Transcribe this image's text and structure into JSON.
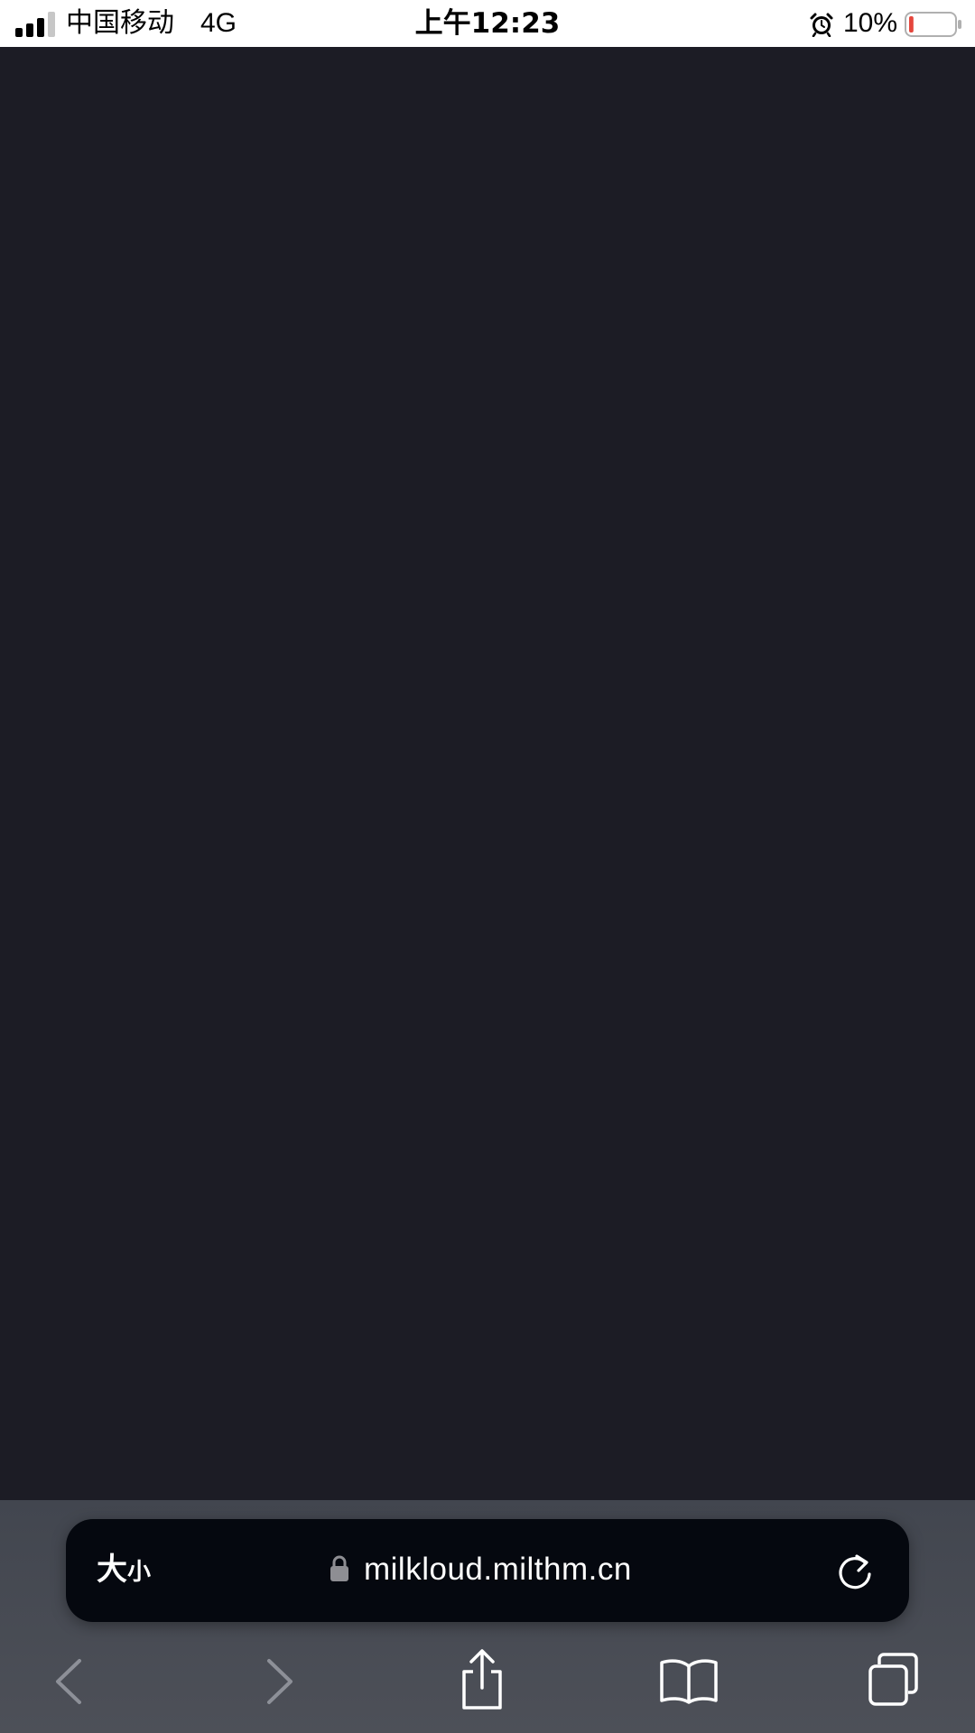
{
  "status_bar": {
    "carrier": "中国移动",
    "network": "4G",
    "time": "上午12:23",
    "battery_percent": "10%",
    "battery_level": 0.1,
    "battery_color": "#e5463c",
    "icons": [
      "signal-icon",
      "alarm-icon",
      "battery-icon"
    ]
  },
  "page": {
    "background": "#1c1c25"
  },
  "browser": {
    "text_size_big": "大",
    "text_size_small": "小",
    "url": "milkloud.milthm.cn",
    "secure": true,
    "toolbar": [
      "back",
      "forward",
      "share",
      "bookmarks",
      "tabs"
    ],
    "icons": [
      "lock-icon",
      "reload-icon",
      "back-icon",
      "forward-icon",
      "share-icon",
      "bookmarks-icon",
      "tabs-icon"
    ]
  }
}
